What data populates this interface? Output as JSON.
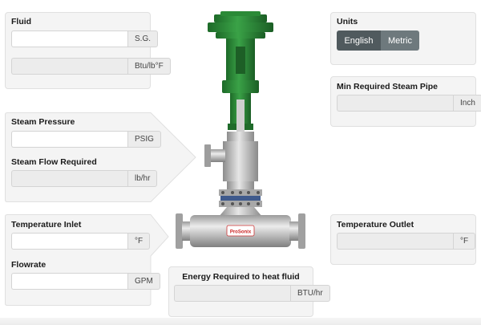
{
  "fluid": {
    "label": "Fluid",
    "sg_value": "",
    "sg_unit": "S.G.",
    "specific_heat_value": "",
    "specific_heat_unit": "Btu/lb°F"
  },
  "units": {
    "label": "Units",
    "options": [
      "English",
      "Metric"
    ],
    "selected": "English"
  },
  "min_steam_pipe": {
    "label": "Min Required Steam Pipe",
    "value": "",
    "unit": "Inch"
  },
  "steam": {
    "pressure_label": "Steam Pressure",
    "pressure_value": "",
    "pressure_unit": "PSIG",
    "flow_label": "Steam Flow Required",
    "flow_value": "",
    "flow_unit": "lb/hr"
  },
  "temperature_inlet": {
    "label": "Temperature Inlet",
    "value": "",
    "unit": "°F"
  },
  "flowrate": {
    "label": "Flowrate",
    "value": "",
    "unit": "GPM"
  },
  "temperature_outlet": {
    "label": "Temperature Outlet",
    "value": "",
    "unit": "°F"
  },
  "energy": {
    "label": "Energy Required to heat fluid",
    "value": "",
    "unit": "BTU/hr"
  },
  "device": {
    "logo_text": "ProSonix",
    "colors": {
      "actuator": "#2e8b3a",
      "actuator_dark": "#1f6b2a",
      "body": "#c9c9c9",
      "body_dark": "#8e8e8e",
      "flange_blue": "#3f5a8c"
    }
  }
}
